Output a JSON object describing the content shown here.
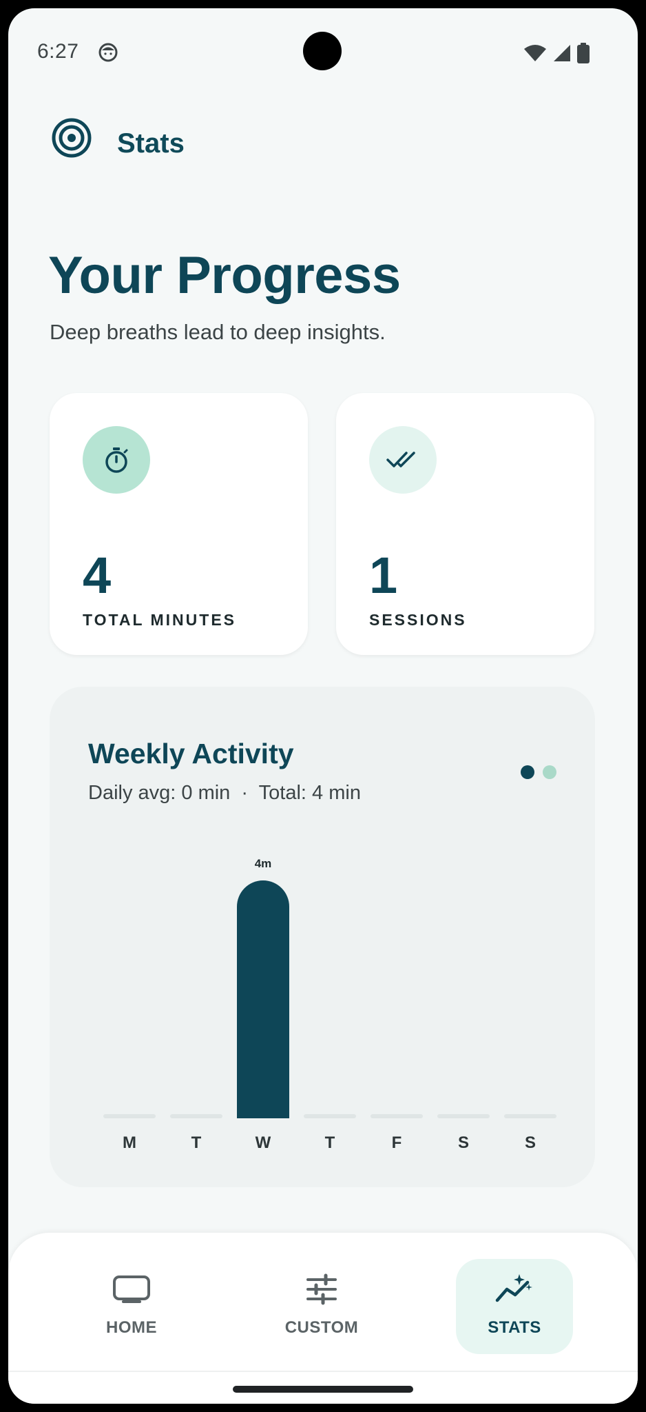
{
  "status_bar": {
    "time": "6:27"
  },
  "header": {
    "app_title": "Stats",
    "logo_icon": "target-icon"
  },
  "page": {
    "title": "Your Progress",
    "subtitle": "Deep breaths lead to deep insights."
  },
  "stats": [
    {
      "value": "4",
      "label": "TOTAL MINUTES",
      "icon": "timer-icon",
      "icon_bg": "#b6e4d3"
    },
    {
      "value": "1",
      "label": "SESSIONS",
      "icon": "double-check-icon",
      "icon_bg": "#e3f4ef"
    }
  ],
  "weekly": {
    "title": "Weekly Activity",
    "summary": "Daily avg: 0 min  ·  Total: 4 min"
  },
  "chart_data": {
    "type": "bar",
    "categories": [
      "M",
      "T",
      "W",
      "T",
      "F",
      "S",
      "S"
    ],
    "values": [
      0,
      0,
      4,
      0,
      0,
      0,
      0
    ],
    "data_labels": [
      "",
      "",
      "4m",
      "",
      "",
      "",
      ""
    ],
    "ylim": [
      0,
      4
    ],
    "bar_color": "#0e4657",
    "grid": false
  },
  "nav": {
    "items": [
      {
        "label": "HOME",
        "icon": "tv-icon",
        "active": false
      },
      {
        "label": "CUSTOM",
        "icon": "sliders-icon",
        "active": false
      },
      {
        "label": "STATS",
        "icon": "sparkle-trend-icon",
        "active": true
      }
    ]
  },
  "colors": {
    "primary": "#0e4657",
    "accent_mint": "#a9d9c8",
    "background": "#f5f8f8"
  }
}
